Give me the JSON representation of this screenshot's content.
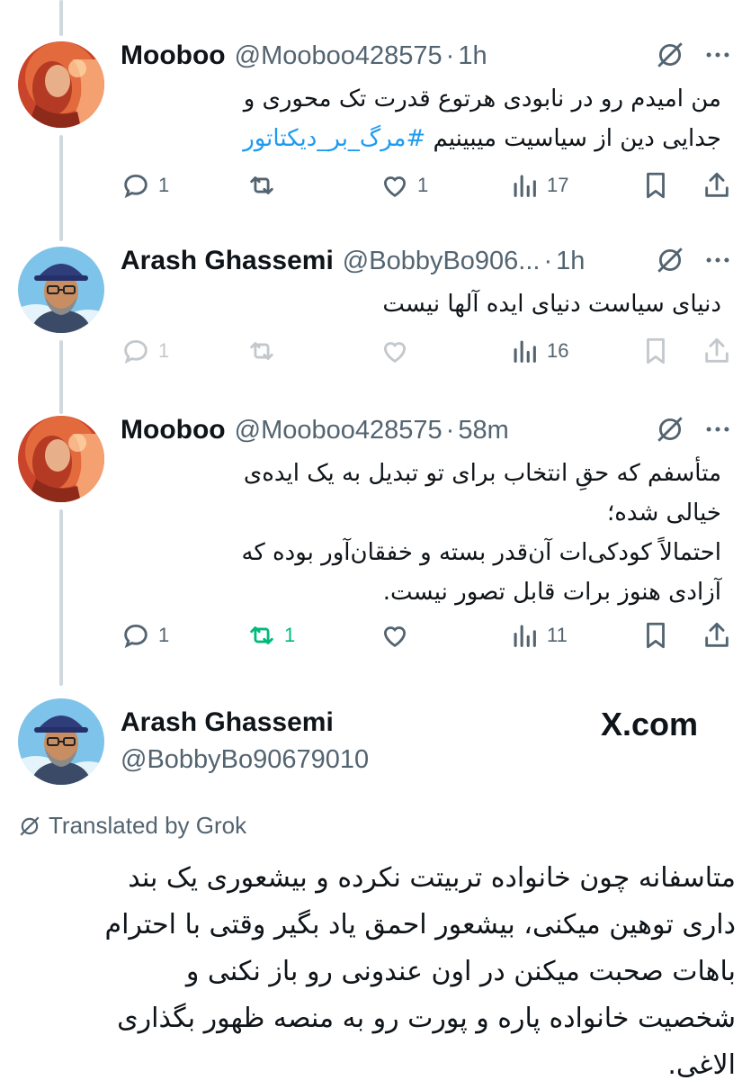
{
  "replies": [
    {
      "name": "Mooboo",
      "handle": "@Mooboo428575",
      "dot": "·",
      "time": "1h",
      "lines": [
        "من امیدم رو در نابودی هرتوع قدرت تک محوری و",
        "جدایی دین از سیاسیت میبینیم "
      ],
      "hashtag": "#مرگ_بر_دیکتاتور",
      "replies_count": "1",
      "retweets_count": "",
      "likes_count": "1",
      "views_count": "17"
    },
    {
      "name": "Arash Ghassemi",
      "handle": "@BobbyBo906...",
      "dot": "·",
      "time": "1h",
      "lines": [
        "دنیای سیاست دنیای ایده آلها نیست"
      ],
      "replies_count": "1",
      "retweets_count": "",
      "likes_count": "",
      "views_count": "16"
    },
    {
      "name": "Mooboo",
      "handle": "@Mooboo428575",
      "dot": "·",
      "time": "58m",
      "lines": [
        "متأسفم که حقِ انتخاب برای تو تبدیل به یک ایده‌ی",
        "خیالی شده؛",
        "احتمالاً کودکی‌ات آن‌قدر بسته و خفقان‌آور بوده که",
        "آزادی هنوز برات قابل تصور نیست."
      ],
      "replies_count": "1",
      "retweets_count": "1",
      "likes_count": "",
      "views_count": "11"
    }
  ],
  "main": {
    "name": "Arash Ghassemi",
    "handle": "@BobbyBo90679010",
    "brand": "X.com",
    "translated_label": "Translated by Grok",
    "lines": [
      "متاسفانه چون خانواده تربیتت نکرده و بیشعوری یک بند",
      "داری توهین میکنی، بیشعور احمق یاد بگیر وقتی با احترام",
      "باهات صحبت میکنن در اون عندونی رو باز نکنی و",
      "شخصیت خانواده پاره و پورت رو به منصه ظهور بگذاری",
      "الاغی."
    ]
  },
  "colors": {
    "accent": "#1d9bf0",
    "muted": "#536471",
    "retweet_active": "#00ba7c",
    "thread_line": "#cfd9de"
  },
  "icons": [
    "reply-icon",
    "retweet-icon",
    "like-icon",
    "views-icon",
    "bookmark-icon",
    "share-icon",
    "grok-icon",
    "more-icon"
  ]
}
